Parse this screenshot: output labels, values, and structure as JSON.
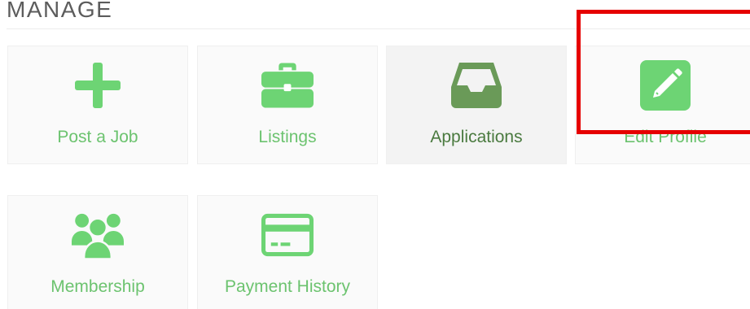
{
  "section": {
    "title": "MANAGE"
  },
  "tiles": [
    {
      "label": "Post a Job",
      "icon": "plus-icon"
    },
    {
      "label": "Listings",
      "icon": "briefcase-icon"
    },
    {
      "label": "Applications",
      "icon": "inbox-tray-icon"
    },
    {
      "label": "Edit Profile",
      "icon": "pencil-square-icon"
    },
    {
      "label": "Membership",
      "icon": "users-group-icon"
    },
    {
      "label": "Payment History",
      "icon": "credit-card-icon"
    }
  ],
  "colors": {
    "accent_green": "#6dd474",
    "active_green": "#6a9a58",
    "label_green": "#6cc36f",
    "highlight_red": "#e60000"
  }
}
